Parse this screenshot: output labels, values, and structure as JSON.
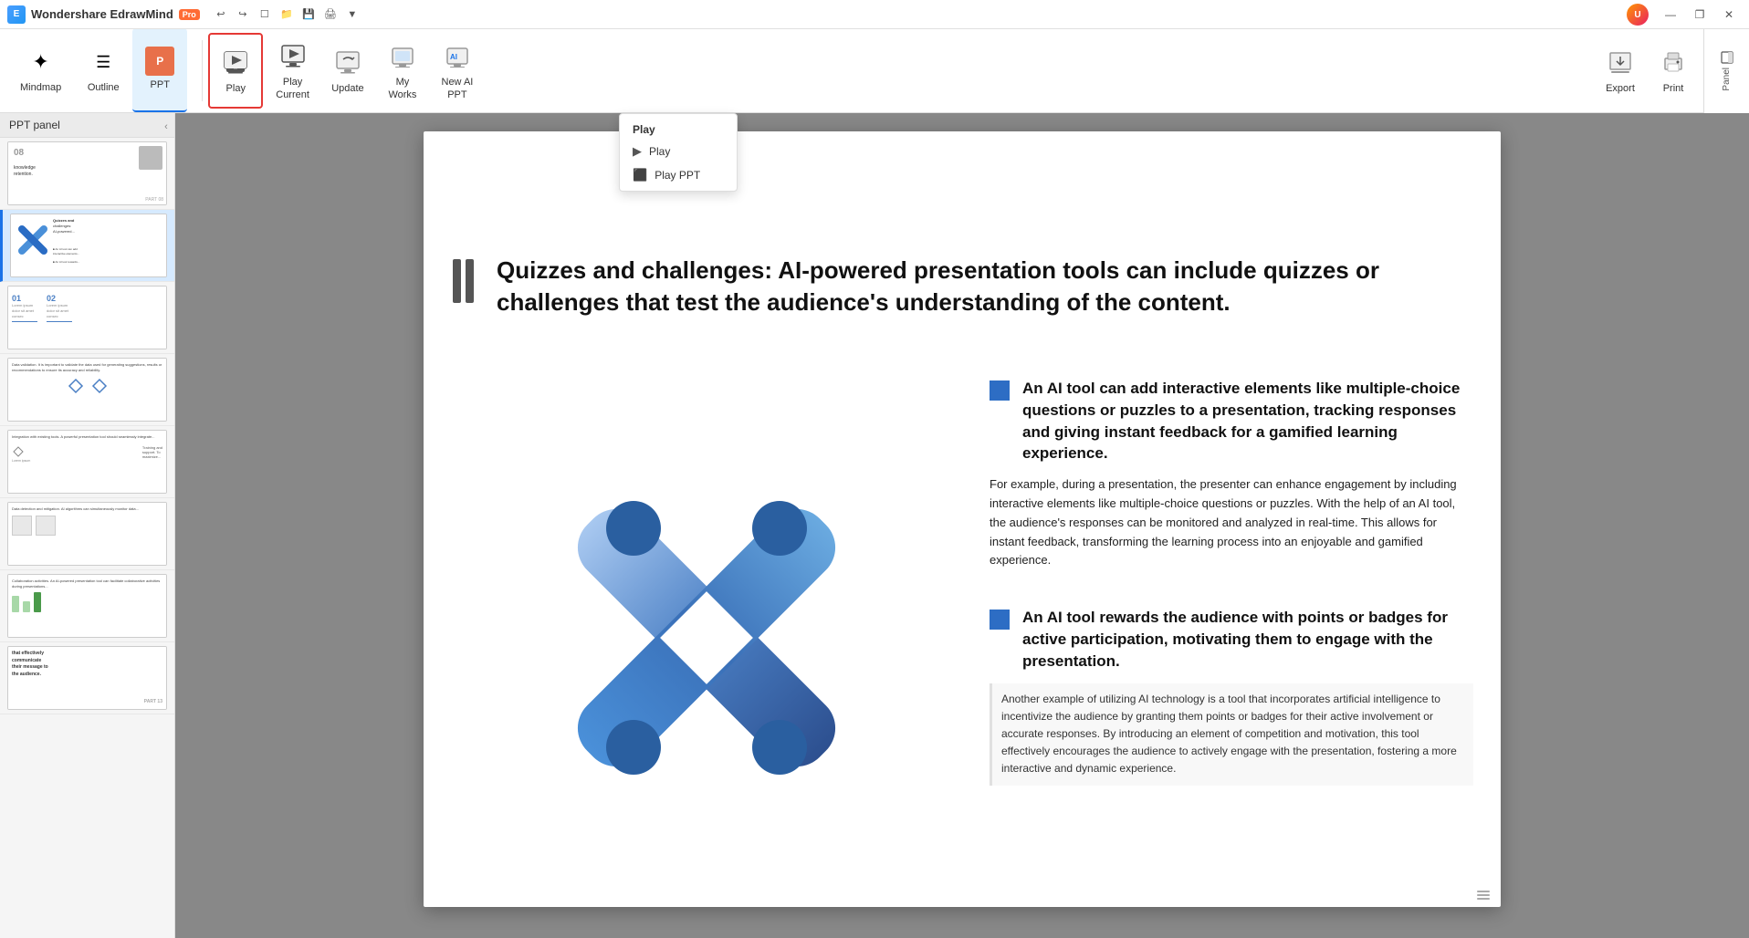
{
  "app": {
    "name": "Wondershare EdrawMind",
    "badge": "Pro",
    "title": "Wondershare EdrawMind Pro"
  },
  "titlebar": {
    "undo": "↩",
    "redo": "↪",
    "new": "📄",
    "open": "📂",
    "save": "💾",
    "print_preview": "🖨",
    "more": "▼",
    "minimize": "—",
    "restore": "❐",
    "close": "✕"
  },
  "ribbon": {
    "tabs": [
      {
        "id": "mindmap",
        "label": "Mindmap"
      },
      {
        "id": "outline",
        "label": "Outline"
      },
      {
        "id": "ppt",
        "label": "PPT",
        "active": true
      }
    ],
    "tools": [
      {
        "id": "play",
        "label": "Play",
        "highlighted": true
      },
      {
        "id": "play_current",
        "label": "Play\nCurrent"
      },
      {
        "id": "update",
        "label": "Update"
      },
      {
        "id": "my_works",
        "label": "My\nWorks"
      },
      {
        "id": "new_ai_ppt",
        "label": "New AI\nPPT"
      }
    ],
    "right_tools": [
      {
        "id": "export",
        "label": "Export"
      },
      {
        "id": "print",
        "label": "Print"
      }
    ]
  },
  "play_dropdown": {
    "header": "Play",
    "items": [
      {
        "id": "play",
        "label": "Play",
        "icon": "▶"
      },
      {
        "id": "play_ppt",
        "label": "Play PPT",
        "icon": "⬛"
      }
    ]
  },
  "sidebar": {
    "title": "PPT panel",
    "slides": [
      {
        "id": 1,
        "type": "knowledge",
        "label": "knowledge retention.",
        "number": "PART 08",
        "has_image": true
      },
      {
        "id": 2,
        "type": "cross_active",
        "label": "Quizzes and challenges",
        "active": true
      },
      {
        "id": 3,
        "type": "numbered",
        "label": "01  02"
      },
      {
        "id": 4,
        "type": "diamond",
        "label": "Data validation"
      },
      {
        "id": 5,
        "type": "integration",
        "label": "Integration with existing tools"
      },
      {
        "id": 6,
        "type": "detection",
        "label": "Data detection and mitigation"
      },
      {
        "id": 7,
        "type": "collaboration",
        "label": "Collaboration activities"
      },
      {
        "id": 8,
        "type": "communicate",
        "label": "effectively communicate their message to the audience."
      }
    ]
  },
  "slide": {
    "pause_icon": "||",
    "title": "Quizzes and challenges: AI-powered presentation tools can include quizzes or challenges that test the audience's understanding of the content.",
    "bullet1": {
      "header": "An AI tool can add interactive elements like multiple-choice questions or puzzles to a presentation, tracking responses and giving instant feedback for a gamified learning experience.",
      "body": "For example, during a presentation, the presenter can enhance engagement by including interactive elements like multiple-choice questions or puzzles. With the help of an AI tool, the audience's responses can be monitored and analyzed in real-time. This allows for instant feedback, transforming the learning process into an enjoyable and gamified experience."
    },
    "bullet2": {
      "header": "An AI tool rewards the audience with points or badges for active participation, motivating them to engage with the presentation.",
      "body": "Another example of utilizing AI technology is a tool that incorporates artificial intelligence to incentivize the audience by granting them points or badges for their active involvement or accurate responses. By introducing an element of competition and motivation, this tool effectively encourages the audience to actively engage with the presentation, fostering a more interactive and dynamic experience."
    }
  },
  "right_panel": {
    "label": "Panel"
  },
  "colors": {
    "accent_blue": "#1a73e8",
    "highlight_red": "#e53935",
    "slide_active_border": "#1a73e8",
    "bullet_square": "#2d6dc4"
  }
}
